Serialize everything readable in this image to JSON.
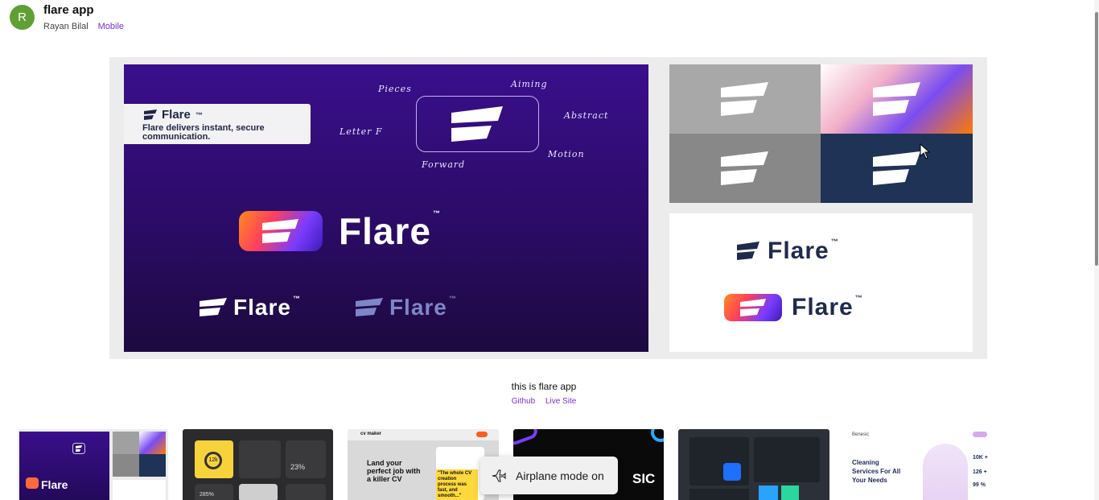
{
  "header": {
    "avatar_initial": "R",
    "title": "flare app",
    "author": "Rayan Bilal",
    "category": "Mobile"
  },
  "hero": {
    "card_brand": "Flare",
    "card_tm": "™",
    "card_tagline": "Flare delivers instant, secure communication.",
    "keywords": {
      "pieces": "Pieces",
      "aiming": "Aiming",
      "abstract": "Abstract",
      "letter_f": "Letter F",
      "motion": "Motion",
      "forward": "Forward"
    },
    "wordmark": "Flare",
    "tm": "™"
  },
  "caption": {
    "description": "this is flare app",
    "github": "Github",
    "live_site": "Live Site"
  },
  "thumbnails": {
    "t2": {
      "label1": "12k",
      "label2": "23%",
      "label3": "285%"
    },
    "t3": {
      "brand": "cv maker",
      "headline": "Land your perfect job with a killer CV",
      "quote": "\"The whole CV creation process was fast, and smooth...\""
    },
    "t4": {
      "text": "SIC"
    },
    "t6": {
      "brand": "Benesic",
      "headline": "Cleaning Services For All Your Needs",
      "stat1": "10K +",
      "stat2": "126 +",
      "stat3": "99 %"
    }
  },
  "toast": {
    "icon": "airplane-icon",
    "text": "Airplane mode on"
  },
  "colors": {
    "accent": "#7b2fd0",
    "avatar": "#5f9f34",
    "hero_bg": "#2a0b63"
  }
}
